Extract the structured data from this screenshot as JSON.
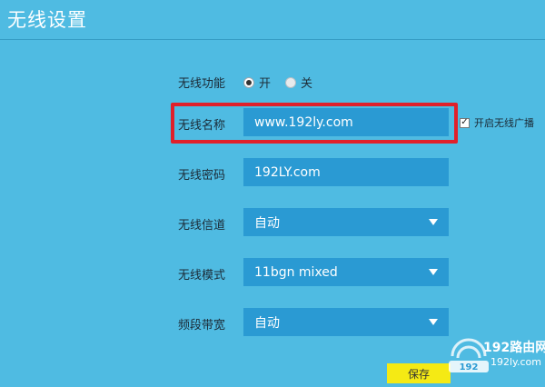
{
  "page": {
    "title": "无线设置"
  },
  "form": {
    "wireless_function": {
      "label": "无线功能",
      "options": [
        {
          "label": "开",
          "checked": true
        },
        {
          "label": "关",
          "checked": false
        }
      ]
    },
    "ssid": {
      "label": "无线名称",
      "value": "www.192ly.com"
    },
    "broadcast": {
      "label": "开启无线广播",
      "checked": true
    },
    "password": {
      "label": "无线密码",
      "value": "192LY.com"
    },
    "channel": {
      "label": "无线信道",
      "value": "自动"
    },
    "mode": {
      "label": "无线模式",
      "value": "11bgn mixed"
    },
    "bandwidth": {
      "label": "频段带宽",
      "value": "自动"
    },
    "save_label": "保存"
  },
  "watermark": {
    "top": "192路由网",
    "bottom": "192ly.com",
    "logo_text": "192"
  },
  "colors": {
    "background": "#4fbbe2",
    "field": "#2a9ad3",
    "highlight": "#e0202a",
    "save_button": "#f5ea14"
  }
}
